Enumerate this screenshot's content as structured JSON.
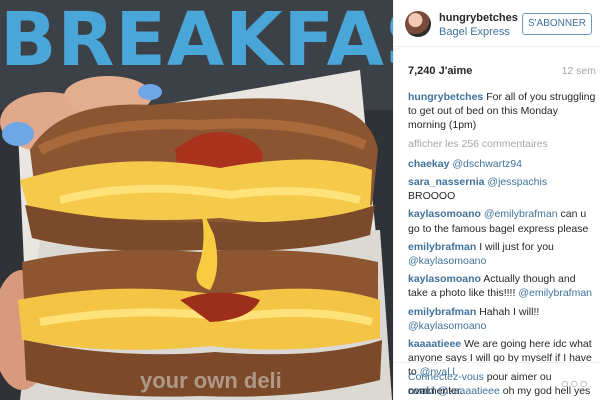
{
  "photo": {
    "sign_text": "BREAKFAST",
    "tagline": "your own deli"
  },
  "post": {
    "username": "hungrybetches",
    "location": "Bagel Express",
    "follow_label": "S'ABONNER",
    "likes": "7,240 J'aime",
    "time": "12 sem",
    "caption_user": "hungrybetches",
    "caption": "For all of you struggling to get out of bed on this Monday morning (1pm)",
    "more_comments": "afficher les 256 commentaires"
  },
  "comments": [
    {
      "user": "chaekay",
      "mention": "@dschwartz94",
      "text": ""
    },
    {
      "user": "sara_nassernia",
      "mention": "@jesspachis",
      "text": "BROOOO"
    },
    {
      "user": "kaylasomoano",
      "mention": "@emilybrafman",
      "text": "can u go to the famous bagel express please"
    },
    {
      "user": "emilybrafman",
      "text_before": "I will just for you",
      "mention": "@kaylasomoano"
    },
    {
      "user": "kaylasomoano",
      "text_before": "Actually though and take a photo like this!!!!",
      "mention": "@emilybrafman"
    },
    {
      "user": "emilybrafman",
      "text_before": "Hahah I will!!",
      "mention": "@kaylasomoano"
    },
    {
      "user": "kaaaatieee",
      "text_before": "We are going here idc what anyone says I will go by myself if I have to",
      "mention": "@nval.l"
    },
    {
      "user": "nval.l",
      "mention": "@kaaaatieee",
      "text": "oh my god hell yes"
    }
  ],
  "footer": {
    "login_link": "Connectez-vous",
    "login_rest": "pour aimer ou commenter.",
    "options_icon": "ellipsis-icon"
  },
  "colors": {
    "link": "#3f729b",
    "sign": "#4aa6d8"
  }
}
